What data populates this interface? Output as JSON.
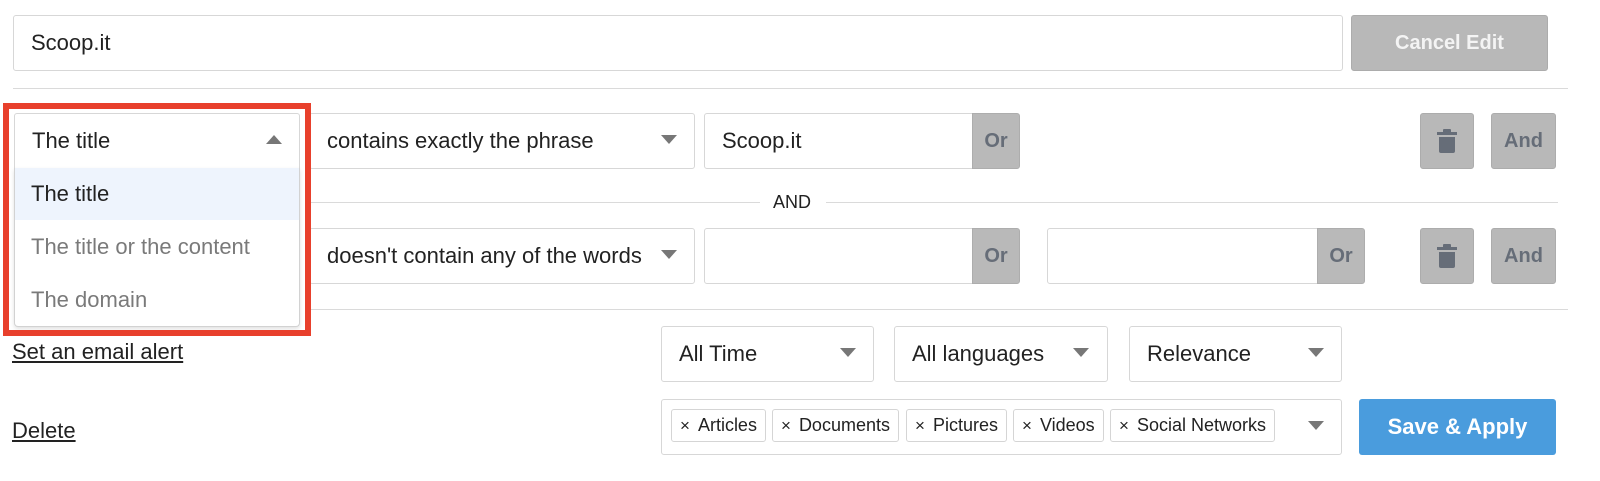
{
  "header": {
    "search_name_value": "Scoop.it",
    "cancel_edit_label": "Cancel Edit"
  },
  "rule1": {
    "field_selected": "The title",
    "operator_selected": "contains exactly the phrase",
    "term1_value": "Scoop.it",
    "or_label": "Or",
    "and_label": "And"
  },
  "dropdown": {
    "options": [
      {
        "label": "The title",
        "selected": true
      },
      {
        "label": "The title or the content",
        "selected": false
      },
      {
        "label": "The domain",
        "selected": false
      }
    ]
  },
  "separator": {
    "label": "AND"
  },
  "rule2": {
    "operator_selected": "doesn't contain any of the words",
    "term1_value": "",
    "term2_value": "",
    "or_label": "Or",
    "and_label": "And"
  },
  "filters": {
    "time_selected": "All Time",
    "language_selected": "All languages",
    "sort_selected": "Relevance",
    "content_types": [
      "Articles",
      "Documents",
      "Pictures",
      "Videos",
      "Social Networks"
    ],
    "chip_remove_glyph": "×"
  },
  "links": {
    "email_alert": "Set an email alert",
    "delete": "Delete"
  },
  "actions": {
    "save_apply_label": "Save & Apply"
  },
  "colors": {
    "highlight": "#e8402c",
    "save_button": "#4a9cdd",
    "gray_button": "#b8b8b8",
    "selected_option_bg": "#eef4fd"
  },
  "icons": {
    "delete_rule": "trash-icon",
    "dropdown_open": "caret-up-icon",
    "dropdown_closed": "caret-down-icon",
    "chip_remove": "close-icon"
  }
}
